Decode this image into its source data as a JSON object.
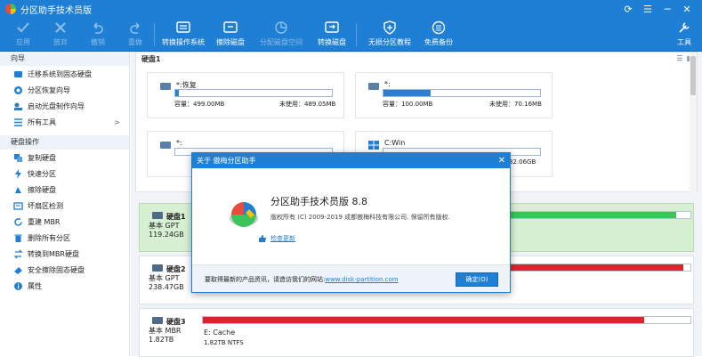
{
  "window": {
    "title": "分区助手技术员版"
  },
  "toolbar": {
    "items": [
      {
        "label": "应用",
        "icon": "check-icon",
        "enabled": false
      },
      {
        "label": "放弃",
        "icon": "cross-icon",
        "enabled": false
      },
      {
        "label": "撤销",
        "icon": "undo-icon",
        "enabled": false
      },
      {
        "label": "重做",
        "icon": "redo-icon",
        "enabled": false
      },
      {
        "label": "转换操作系统",
        "icon": "convert-disk-icon",
        "enabled": true
      },
      {
        "label": "擦除磁盘",
        "icon": "erase-disk-icon",
        "enabled": true
      },
      {
        "label": "分配磁盘空间",
        "icon": "allocate-space-icon",
        "enabled": false
      },
      {
        "label": "转换磁盘",
        "icon": "convert-icon",
        "enabled": true
      },
      {
        "label": "无损分区教程",
        "icon": "shield-icon",
        "enabled": true
      },
      {
        "label": "免费备份",
        "icon": "backup-icon",
        "enabled": true
      },
      {
        "label": "工具",
        "icon": "tools-icon",
        "enabled": true
      }
    ]
  },
  "sidebar": {
    "wizard_header": "向导",
    "wizard_items": [
      {
        "label": "迁移系统到固态硬盘",
        "icon": "migrate-icon"
      },
      {
        "label": "分区恢复向导",
        "icon": "recovery-icon"
      },
      {
        "label": "启动光盘制作向导",
        "icon": "bootdisk-icon"
      },
      {
        "label": "所有工具",
        "icon": "tools-list-icon",
        "arrow": ">"
      }
    ],
    "disk_header": "硬盘操作",
    "disk_items": [
      {
        "label": "复制硬盘",
        "icon": "copy-disk-icon"
      },
      {
        "label": "快速分区",
        "icon": "quick-partition-icon"
      },
      {
        "label": "擦除硬盘",
        "icon": "erase-icon"
      },
      {
        "label": "坏扇区检测",
        "icon": "badsector-icon"
      },
      {
        "label": "重建 MBR",
        "icon": "rebuild-mbr-icon"
      },
      {
        "label": "删除所有分区",
        "icon": "delete-all-icon"
      },
      {
        "label": "转换到MBR硬盘",
        "icon": "convert-mbr-icon"
      },
      {
        "label": "安全擦除固态硬盘",
        "icon": "secure-erase-icon"
      },
      {
        "label": "属性",
        "icon": "info-icon"
      }
    ]
  },
  "volumes_panel": {
    "title": "硬盘1",
    "cards": [
      {
        "name": "*:恢复",
        "capacity": "容量：499.00MB",
        "free": "未使用：489.05MB",
        "fill": 0.02
      },
      {
        "name": "*:",
        "capacity": "容量：100.00MB",
        "free": "未使用：70.16MB",
        "fill": 0.3
      },
      {
        "name": "*:",
        "capacity": "",
        "free": "",
        "fill": 0.0
      },
      {
        "name": "C:Win",
        "capacity": "",
        "free": "32.06GB",
        "fill": 0.0
      }
    ]
  },
  "disks": [
    {
      "name": "硬盘1",
      "type": "基本 GPT",
      "size": "119.24GB",
      "selected": true,
      "bar_color": "#3cc35a",
      "fill": 0.97,
      "label": "",
      "sublabel": ""
    },
    {
      "name": "硬盘2",
      "type": "基本 GPT",
      "size": "238.47GB",
      "selected": false,
      "bar_color": "#d9252d",
      "fill": 0.985,
      "label": "",
      "sublabel": ""
    },
    {
      "name": "硬盘3",
      "type": "基本 MBR",
      "size": "1.82TB",
      "selected": false,
      "bar_color": "#d9252d",
      "fill": 0.905,
      "label": "E: Cache",
      "sublabel": "1.82TB NTFS"
    }
  ],
  "dialog": {
    "title": "关于 傲梅分区助手",
    "product": "分区助手技术员版 8.8",
    "copyright": "版权所有 (C) 2009-2019 成都傲梅科技有限公司. 保留所有版权.",
    "check_update": "检查更新",
    "footer_text": "要取得最新的产品资讯，请造访我们的网站:",
    "footer_link": "www.disk-partition.com",
    "ok_label": "确定(O)"
  },
  "colors": {
    "accent": "#1e7fd4",
    "selected_row": "#d7f0d3",
    "used_bar": "#2d7fd3"
  }
}
